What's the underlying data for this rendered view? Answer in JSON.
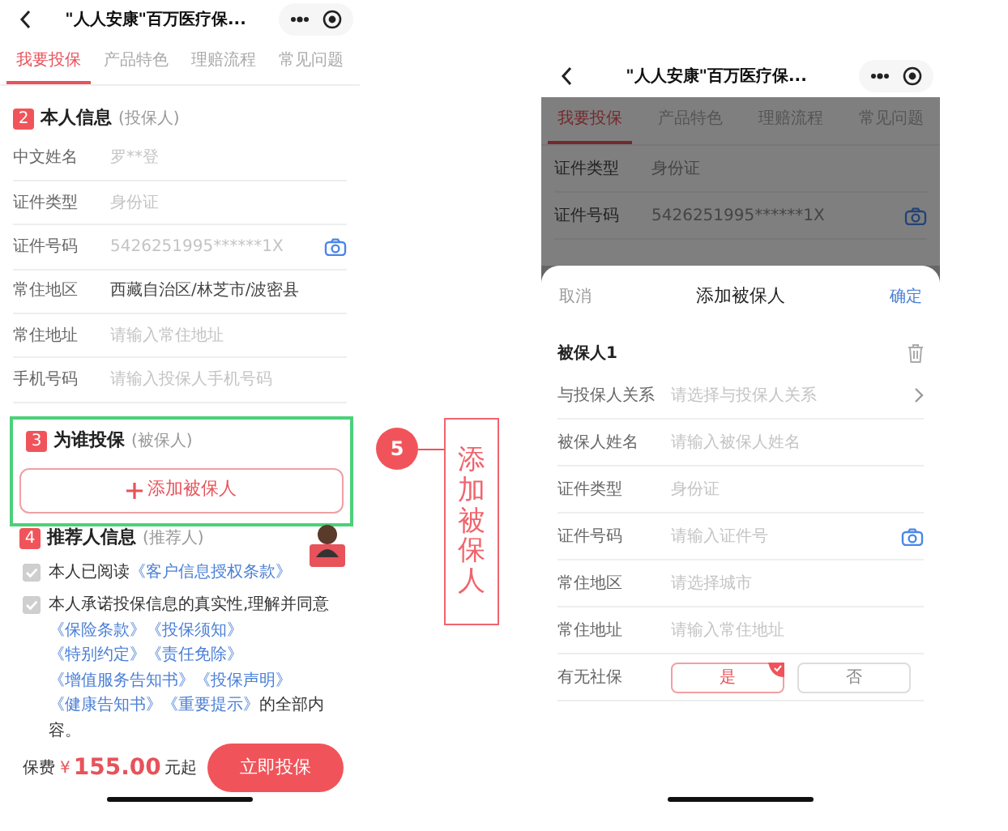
{
  "left_screen": {
    "title": "\"人人安康\"百万医疗保...",
    "tabs": [
      {
        "label": "我要投保",
        "selected": true
      },
      {
        "label": "产品特色",
        "selected": false
      },
      {
        "label": "理赔流程",
        "selected": false
      },
      {
        "label": "常见问题",
        "selected": false
      }
    ],
    "applicant_section": {
      "number": "2",
      "title": "本人信息",
      "subtitle": "(投保人)",
      "fields": [
        {
          "label": "中文姓名",
          "placeholder": "罗**登",
          "kind": "text"
        },
        {
          "label": "证件类型",
          "placeholder": "身份证",
          "kind": "text"
        },
        {
          "label": "证件号码",
          "placeholder": "5426251995******1X",
          "kind": "camera"
        },
        {
          "label": "常住地区",
          "value": "西藏自治区/林芝市/波密县",
          "kind": "text"
        },
        {
          "label": "常住地址",
          "placeholder": "请输入常住地址",
          "kind": "text"
        },
        {
          "label": "手机号码",
          "placeholder": "请输入投保人手机号码",
          "kind": "text"
        }
      ]
    },
    "insured_section": {
      "number": "3",
      "title": "为谁投保",
      "subtitle": "(被保人)",
      "add_button": "添加被保人",
      "highlighted": true
    },
    "recommender_section": {
      "number": "4",
      "title": "推荐人信息",
      "subtitle": "(推荐人)"
    },
    "agreements": [
      {
        "checked": true,
        "parts": [
          {
            "text": "本人已阅读",
            "link": false
          },
          {
            "text": "《客户信息授权条款》",
            "link": true
          }
        ]
      },
      {
        "checked": true,
        "parts": [
          {
            "text": "本人承诺投保信息的真实性,理解并同意",
            "link": false
          },
          {
            "text": "《保险条款》",
            "link": true
          },
          {
            "text": "《投保须知》",
            "link": true
          },
          {
            "text": "《特别约定》",
            "link": true
          },
          {
            "text": "《责任免除》",
            "link": true
          },
          {
            "text": "《增值服务告知书》",
            "link": true
          },
          {
            "text": "《投保声明》",
            "link": true
          },
          {
            "text": "《健康告知书》",
            "link": true
          },
          {
            "text": "《重要提示》",
            "link": true
          },
          {
            "text": "的全部内容。",
            "link": false
          }
        ]
      }
    ],
    "footer": {
      "premium_label": "保费",
      "currency": "¥",
      "amount": "155.00",
      "unit": "元起",
      "submit_button": "立即投保"
    }
  },
  "annotation": {
    "step": "5",
    "label": "添加被保人"
  },
  "right_screen": {
    "title": "\"人人安康\"百万医疗保...",
    "tabs": [
      {
        "label": "我要投保",
        "selected": true
      },
      {
        "label": "产品特色",
        "selected": false
      },
      {
        "label": "理赔流程",
        "selected": false
      },
      {
        "label": "常见问题",
        "selected": false
      }
    ],
    "background_fields": [
      {
        "label": "证件类型",
        "placeholder": "身份证",
        "kind": "text"
      },
      {
        "label": "证件号码",
        "placeholder": "5426251995******1X",
        "kind": "camera"
      }
    ],
    "sheet": {
      "cancel": "取消",
      "title": "添加被保人",
      "confirm": "确定",
      "insured_title": "被保人1",
      "fields": [
        {
          "label": "与投保人关系",
          "placeholder": "请选择与投保人关系",
          "kind": "select"
        },
        {
          "label": "被保人姓名",
          "placeholder": "请输入被保人姓名",
          "kind": "text"
        },
        {
          "label": "证件类型",
          "placeholder": "身份证",
          "kind": "text"
        },
        {
          "label": "证件号码",
          "placeholder": "请输入证件号",
          "kind": "camera"
        },
        {
          "label": "常住地区",
          "placeholder": "请选择城市",
          "kind": "text"
        },
        {
          "label": "常住地址",
          "placeholder": "请输入常住地址",
          "kind": "text"
        }
      ],
      "social_security": {
        "label": "有无社保",
        "options": [
          {
            "label": "是",
            "selected": true
          },
          {
            "label": "否",
            "selected": false
          }
        ]
      }
    }
  }
}
